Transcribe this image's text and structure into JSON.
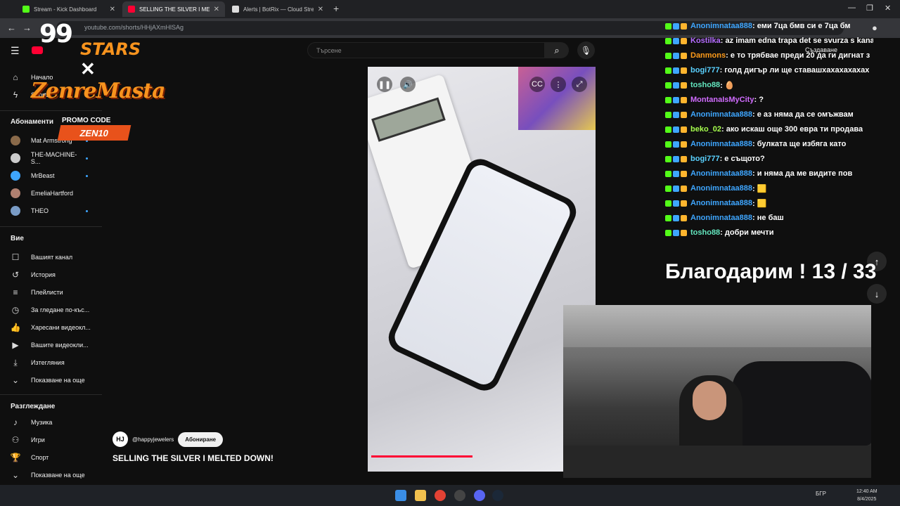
{
  "browser": {
    "tabs": [
      {
        "title": "Stream - Kick Dashboard",
        "favicon_color": "#53fc18"
      },
      {
        "title": "SELLING THE SILVER I MELT",
        "favicon_color": "#ff0033"
      },
      {
        "title": "Alerts | BotRix — Cloud Stream",
        "favicon_color": "#dddddd"
      }
    ],
    "new_tab": "+",
    "url": "youtube.com/shorts/HHjAXmHlSAg"
  },
  "youtube": {
    "search_placeholder": "Търсене",
    "create_label": "Създаване",
    "sidebar": {
      "main": [
        {
          "label": "Начало",
          "icon": "home-icon"
        },
        {
          "label": "Shorts",
          "icon": "shorts-icon"
        }
      ],
      "subscriptions_heading": "Абонаменти",
      "subscriptions": [
        {
          "label": "Mat Armstrong",
          "color": "#8a6a4a",
          "dot": true
        },
        {
          "label": "THE-MACHINE-S...",
          "color": "#cccccc",
          "dot": true
        },
        {
          "label": "MrBeast",
          "color": "#3ea6ff",
          "dot": true
        },
        {
          "label": "EmeliaHartford",
          "color": "#b08070",
          "dot": false
        },
        {
          "label": "THEO",
          "color": "#7a9cc6",
          "dot": true
        }
      ],
      "you_heading": "Вие",
      "you": [
        {
          "label": "Вашият канал",
          "icon": "channel-icon"
        },
        {
          "label": "История",
          "icon": "history-icon"
        },
        {
          "label": "Плейлисти",
          "icon": "playlist-icon"
        },
        {
          "label": "За гледане по-къс...",
          "icon": "watch-later-icon"
        },
        {
          "label": "Харесани видеокл...",
          "icon": "like-icon"
        },
        {
          "label": "Вашите видеокли...",
          "icon": "your-videos-icon"
        },
        {
          "label": "Изтегляния",
          "icon": "download-icon"
        },
        {
          "label": "Показване на още",
          "icon": "chevron-down-icon"
        }
      ],
      "explore_heading": "Разглеждане",
      "explore": [
        {
          "label": "Музика",
          "icon": "music-icon"
        },
        {
          "label": "Игри",
          "icon": "gaming-icon"
        },
        {
          "label": "Спорт",
          "icon": "trophy-icon"
        },
        {
          "label": "Показване на още",
          "icon": "chevron-down-icon"
        }
      ]
    },
    "short": {
      "channel_initials": "HJ",
      "channel_handle": "@happyjewelers",
      "subscribe_label": "Абониране",
      "title": "SELLING THE SILVER I MELTED DOWN!",
      "progress_fraction": 0.46
    }
  },
  "overlay": {
    "logo_number": "99",
    "logo_brand": "STARS",
    "logo_x": "✕",
    "logo_partner": "ZenreMasta",
    "promo_label": "PROMO CODE",
    "promo_code": "ZEN10",
    "chat": [
      {
        "user": "Anonimnataa888",
        "color": "#3ea6ff",
        "msg": " : еми 7ца бмв си е 7ца бм"
      },
      {
        "user": "Kostilka",
        "color": "#b56cff",
        "msg": " : az imam edna trapa det se svurza s kana"
      },
      {
        "user": "Danmons",
        "color": "#ff9b1a",
        "msg": " : е то трябвае преди 20 да ги дигнат з"
      },
      {
        "user": "bogi777",
        "color": "#5ad1ff",
        "msg": " : голд дигър ли ще ставашхахахахахах"
      },
      {
        "user": "tosho88",
        "color": "#63e6be",
        "msg": " : 🥚"
      },
      {
        "user": "MontanaIsMyCity",
        "color": "#d16cff",
        "msg": " : ?"
      },
      {
        "user": "Anonimnataa888",
        "color": "#3ea6ff",
        "msg": " : е аз няма да се омъжвам"
      },
      {
        "user": "beko_02",
        "color": "#a6ff4d",
        "msg": " : ако искаш още 300 евра ти продава"
      },
      {
        "user": "Anonimnataa888",
        "color": "#3ea6ff",
        "msg": " : булката ще избяга като"
      },
      {
        "user": "bogi777",
        "color": "#5ad1ff",
        "msg": " : е същото?"
      },
      {
        "user": "Anonimnataa888",
        "color": "#3ea6ff",
        "msg": " : и няма да ме видите пов"
      },
      {
        "user": "Anonimnataa888",
        "color": "#3ea6ff",
        "msg": " : 🟨"
      },
      {
        "user": "Anonimnataa888",
        "color": "#3ea6ff",
        "msg": " : 🟨"
      },
      {
        "user": "Anonimnataa888",
        "color": "#3ea6ff",
        "msg": " : не баш"
      },
      {
        "user": "tosho88",
        "color": "#63e6be",
        "msg": " : добри мечти"
      }
    ],
    "goal_text": "Благодарим ! 13 / 33"
  },
  "taskbar": {
    "lang": "БГР",
    "time": "12:40 AM",
    "date": "8/4/2025"
  }
}
